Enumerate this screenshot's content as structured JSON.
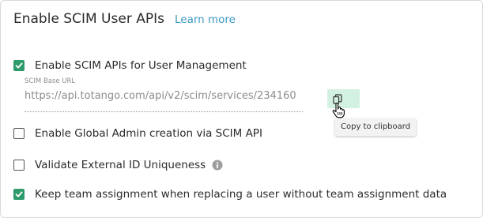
{
  "header": {
    "title": "Enable SCIM User APIs",
    "learn_more": "Learn more"
  },
  "options": [
    {
      "label": "Enable SCIM APIs for User Management",
      "checked": true
    },
    {
      "label": "Enable Global Admin creation via SCIM API",
      "checked": false
    },
    {
      "label": "Validate External ID Uniqueness",
      "checked": false
    },
    {
      "label": "Keep team assignment when replacing a user without team assignment data",
      "checked": true
    }
  ],
  "scim_url": {
    "caption": "SCIM Base URL",
    "value": "https://api.totango.com/api/v2/scim/services/234160"
  },
  "copy": {
    "tooltip": "Copy to clipboard"
  },
  "icons": {
    "copy": "copy-icon",
    "info": "info-icon",
    "cursor": "hand-pointer-icon",
    "check": "checkmark-icon"
  },
  "colors": {
    "accent_green": "#2f9a6c",
    "link_blue": "#3d98c2",
    "copy_highlight": "#d3f1e0"
  }
}
